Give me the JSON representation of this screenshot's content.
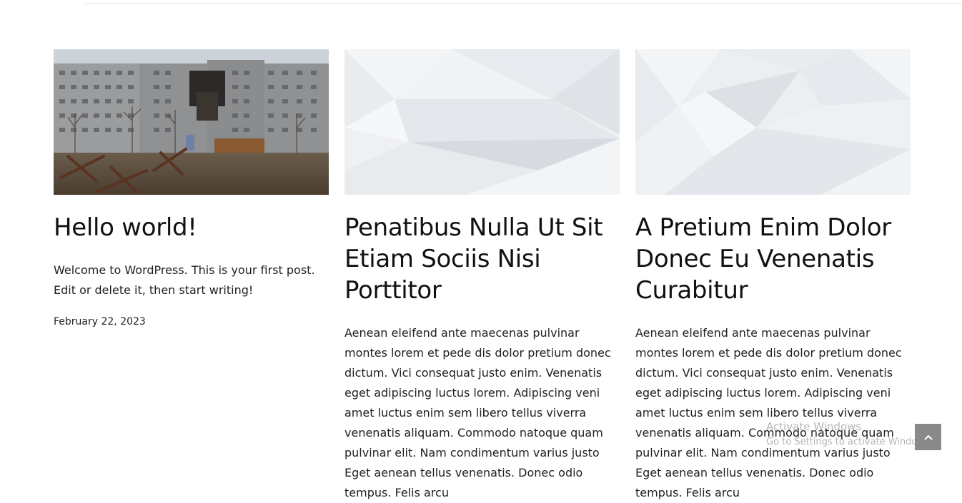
{
  "posts": [
    {
      "title": "Hello world!",
      "excerpt": "Welcome to WordPress. This is your first post. Edit or delete it, then start writing!",
      "date": "February 22, 2023",
      "image": "damaged-apartment-building-photo"
    },
    {
      "title": "Penatibus Nulla Ut Sit Etiam Sociis Nisi Porttitor",
      "excerpt": "Aenean eleifend ante maecenas pulvinar montes lorem et pede dis dolor pretium donec dictum. Vici consequat justo enim. Venenatis eget adipiscing luctus lorem. Adipiscing veni amet luctus enim sem libero tellus viverra venenatis aliquam. Commodo natoque quam pulvinar elit. Nam condimentum varius justo Eget aenean tellus venenatis. Donec odio tempus. Felis arcu",
      "image": "abstract-white-polygon-background"
    },
    {
      "title": "A Pretium Enim Dolor Donec Eu Venenatis Curabitur",
      "excerpt": "Aenean eleifend ante maecenas pulvinar montes lorem et pede dis dolor pretium donec dictum. Vici consequat justo enim. Venenatis eget adipiscing luctus lorem. Adipiscing veni amet luctus enim sem libero tellus viverra venenatis aliquam. Commodo natoque quam pulvinar elit. Nam condimentum varius justo Eget aenean tellus venenatis. Donec odio tempus. Felis arcu",
      "image": "abstract-white-polygon-background"
    }
  ],
  "watermark": {
    "line1": "Activate Windows",
    "line2": "Go to Settings to activate Windows."
  },
  "scroll_top": {
    "icon": "chevron-up-icon",
    "color": "#8a8a8a"
  }
}
